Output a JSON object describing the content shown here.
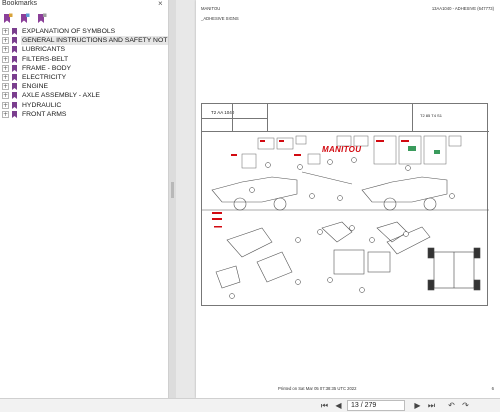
{
  "bookmarks": {
    "title": "Bookmarks",
    "close_glyph": "×",
    "items": [
      {
        "label": "EXPLANATION OF SYMBOLS",
        "selected": false
      },
      {
        "label": "GENERAL INSTRUCTIONS AND SAFETY NOTICE",
        "selected": true
      },
      {
        "label": "LUBRICANTS",
        "selected": false
      },
      {
        "label": "FILTERS-BELT",
        "selected": false
      },
      {
        "label": "FRAME - BODY",
        "selected": false
      },
      {
        "label": "ELECTRICITY",
        "selected": false
      },
      {
        "label": "ENGINE",
        "selected": false
      },
      {
        "label": "AXLE ASSEMBLY - AXLE",
        "selected": false
      },
      {
        "label": "HYDRAULIC",
        "selected": false
      },
      {
        "label": "FRONT ARMS",
        "selected": false
      }
    ],
    "expand_glyph": "+",
    "colors": {
      "bookmark_icon": "#7a3e8e",
      "tool_icon": "#8b3f99"
    }
  },
  "document": {
    "brand": "MANITOU",
    "reference": "13AA1040 - ADHESIVE (647773)",
    "section": "_ADHESIVE SIGNS",
    "title_box": {
      "code": "T2 AA 1040",
      "right_code": "T2 85 T4 S1"
    },
    "logo": "MANITOU",
    "footer": "Printed on   Sat Mar 05 07:38:35 UTC 2022",
    "page_number": "6",
    "accent_color": "#d20a11"
  },
  "nav": {
    "page_display": "13 / 279",
    "icons": [
      "first-page-icon",
      "previous-page-icon",
      "next-page-icon",
      "last-page-icon",
      "back-icon",
      "forward-icon"
    ]
  }
}
